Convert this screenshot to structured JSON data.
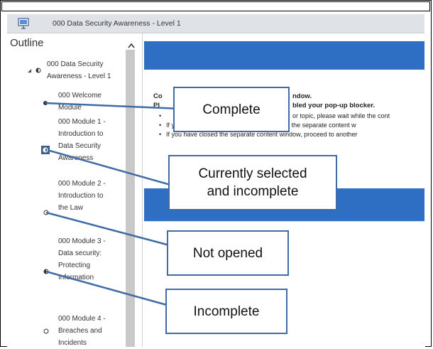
{
  "window": {
    "title": "000 Data Security Awareness - Level 1",
    "app_icon": "presentation-icon"
  },
  "outline": {
    "header": "Outline",
    "collapse_icon": "caret-up-icon",
    "root": {
      "lines": [
        "000 Data Security",
        "Awareness - Level 1"
      ],
      "status_icon": "half-filled-circle-icon"
    },
    "items": [
      {
        "lines": [
          "000 Welcome",
          "Module"
        ],
        "status": "complete",
        "icon": "filled-dot-icon"
      },
      {
        "lines": [
          "000 Module 1 -",
          "Introduction to",
          "Data Security",
          "Awareness"
        ],
        "status": "selected-incomplete",
        "icon": "selected-square-icon"
      },
      {
        "lines": [
          "000 Module 2 -",
          "Introduction to",
          "the Law"
        ],
        "status": "not-opened",
        "icon": "empty-circle-icon"
      },
      {
        "lines": [
          "000 Module 3 -",
          "Data security:",
          "Protecting",
          "Information"
        ],
        "status": "incomplete",
        "icon": "half-circle-icon"
      },
      {
        "lines": [
          "000 Module 4 -",
          "Breaches and",
          "Incidents"
        ],
        "status": "not-opened",
        "icon": "empty-circle-icon"
      }
    ]
  },
  "content": {
    "heading_start": "Co",
    "heading_end": "ndow.",
    "line2_start": "Pl",
    "line2_end": "bled your pop-up blocker.",
    "bullets": [
      "or topic, please wait while the cont",
      "If your content has already loaded, return to the separate content w",
      "If you have closed the separate content window, proceed to another"
    ]
  },
  "callouts": {
    "complete": "Complete",
    "selected": "Currently selected and incomplete",
    "not_opened": "Not opened",
    "incomplete": "Incomplete"
  },
  "colors": {
    "accent_blue": "#2e6fc4",
    "callout_border": "#3f6ca6",
    "titlebar": "#dfe3e7",
    "selected_icon": "#3b5f8f"
  }
}
